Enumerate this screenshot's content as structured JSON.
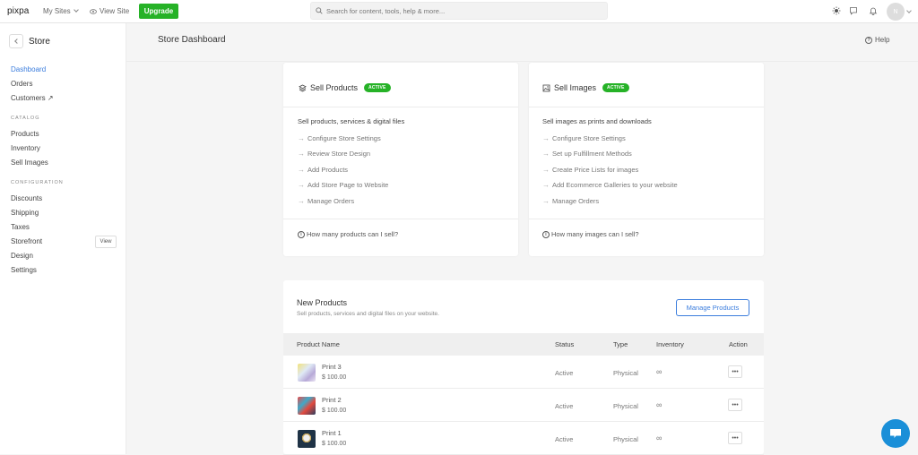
{
  "topbar": {
    "logo": "pixpa",
    "my_sites_label": "My Sites",
    "view_site_label": "View Site",
    "upgrade_label": "Upgrade",
    "search_placeholder": "Search for content, tools, help & more...",
    "avatar_initial": "N",
    "colors": {
      "upgrade": "#26b227"
    }
  },
  "sidebar": {
    "back_title": "Store",
    "items": [
      {
        "label": "Dashboard",
        "active": true
      },
      {
        "label": "Orders"
      },
      {
        "label": "Customers ↗"
      }
    ],
    "catalog_heading": "CATALOG",
    "catalog_items": [
      {
        "label": "Products"
      },
      {
        "label": "Inventory"
      },
      {
        "label": "Sell Images"
      }
    ],
    "config_heading": "CONFIGURATION",
    "config_items": [
      {
        "label": "Discounts"
      },
      {
        "label": "Shipping"
      },
      {
        "label": "Taxes"
      },
      {
        "label": "Storefront"
      },
      {
        "label": "Design"
      },
      {
        "label": "Settings"
      }
    ],
    "storefront_view_label": "View"
  },
  "header": {
    "title": "Store Dashboard",
    "help_label": "Help"
  },
  "cards": [
    {
      "title": "Sell Products",
      "badge": "ACTIVE",
      "subtitle": "Sell products, services & digital files",
      "links": [
        "Configure Store Settings",
        "Review Store Design",
        "Add Products",
        "Add Store Page to Website",
        "Manage Orders"
      ],
      "faq": "How many products can I sell?"
    },
    {
      "title": "Sell Images",
      "badge": "ACTIVE",
      "subtitle": "Sell images as prints and downloads",
      "links": [
        "Configure Store Settings",
        "Set up Fulfillment Methods",
        "Create Price Lists for images",
        "Add Ecommerce Galleries to your website",
        "Manage Orders"
      ],
      "faq": "How many images can I sell?"
    }
  ],
  "new_products": {
    "title": "New Products",
    "subtitle": "Sell products, services and digital files on your website.",
    "manage_button": "Manage Products",
    "columns": [
      "Product Name",
      "Status",
      "Type",
      "Inventory",
      "Action"
    ],
    "rows": [
      {
        "name": "Print 3",
        "price": "$ 100.00",
        "status": "Active",
        "type": "Physical",
        "inventory": "∞",
        "action": "•••"
      },
      {
        "name": "Print 2",
        "price": "$ 100.00",
        "status": "Active",
        "type": "Physical",
        "inventory": "∞",
        "action": "•••"
      },
      {
        "name": "Print 1",
        "price": "$ 100.00",
        "status": "Active",
        "type": "Physical",
        "inventory": "∞",
        "action": "•••"
      }
    ]
  }
}
